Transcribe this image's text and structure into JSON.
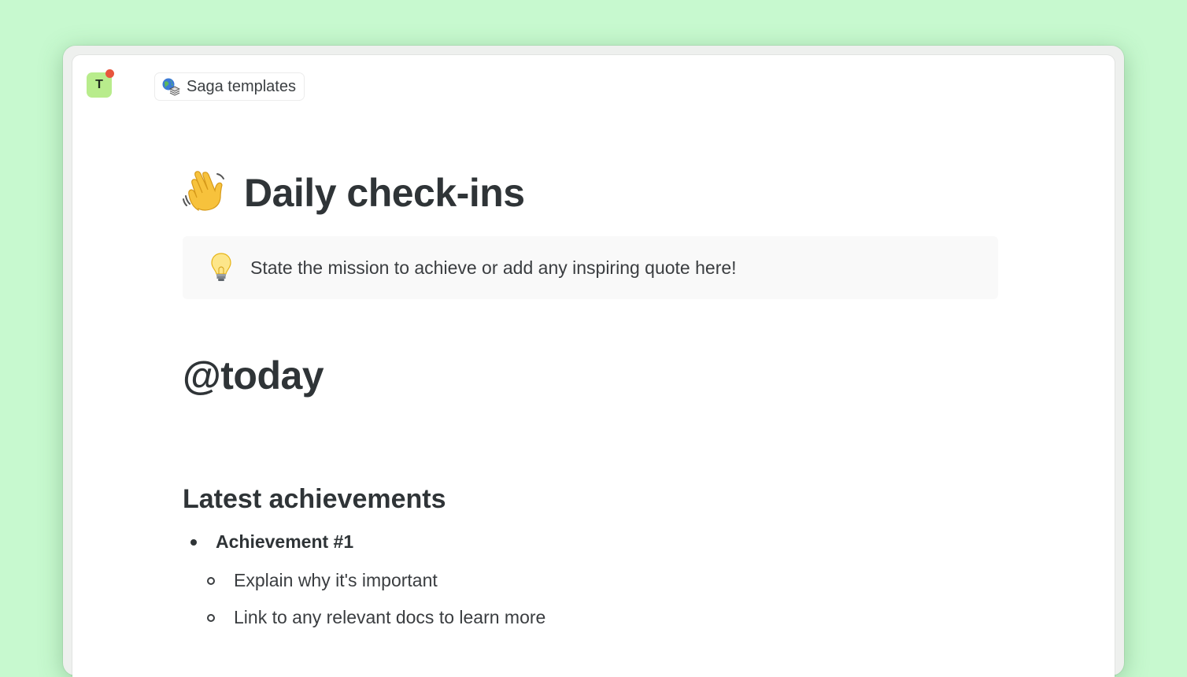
{
  "topbar": {
    "avatar_letter": "T",
    "workspace_label": "Saga templates",
    "workspace_icon": "globe-stack-icon"
  },
  "page": {
    "title_emoji": "waving-hand-icon",
    "title": "Daily check-ins",
    "callout": {
      "icon": "light-bulb-icon",
      "text": "State the mission to achieve or add any inspiring quote here!"
    },
    "date_heading": "@today",
    "section_heading": "Latest achievements",
    "achievement": {
      "label": "Achievement #1",
      "sub_items": [
        "Explain why it's important",
        "Link to any relevant docs to learn more"
      ]
    }
  },
  "colors": {
    "background": "#c7f9cf",
    "avatar_bg": "#b8ec8c",
    "notification_dot": "#e8553d",
    "text": "#2f3437",
    "callout_bg": "#f9f9f9"
  }
}
